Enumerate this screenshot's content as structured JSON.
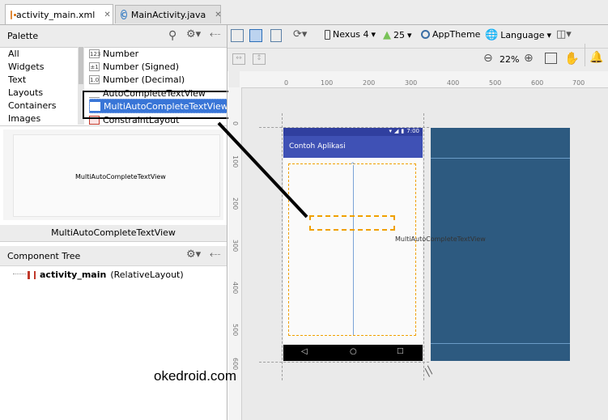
{
  "tabs": [
    {
      "label": "activity_main.xml",
      "active": true
    },
    {
      "label": "MainActivity.java",
      "active": false
    }
  ],
  "palette": {
    "title": "Palette",
    "categories": [
      "All",
      "Widgets",
      "Text",
      "Layouts",
      "Containers",
      "Images"
    ],
    "items": [
      {
        "icon_text": "123",
        "label": "Number"
      },
      {
        "icon_text": "±1",
        "label": "Number (Signed)"
      },
      {
        "icon_text": "1.0",
        "label": "Number (Decimal)"
      },
      {
        "icon_text": "",
        "label": "AutoCompleteTextView"
      },
      {
        "icon_text": "",
        "label": "MultiAutoCompleteTextView",
        "selected": true
      },
      {
        "icon_text": "",
        "label": "ConstraintLayout"
      }
    ],
    "preview_text": "MultiAutoCompleteTextView",
    "preview_caption": "MultiAutoCompleteTextView"
  },
  "component_tree": {
    "title": "Component Tree",
    "root_name": "activity_main",
    "root_type": "(RelativeLayout)"
  },
  "toolbar": {
    "device": "Nexus 4",
    "api": "25",
    "theme": "AppTheme",
    "language": "Language",
    "zoom": "22%"
  },
  "ruler": {
    "h_ticks": [
      "0",
      "100",
      "200",
      "300",
      "400",
      "500",
      "600",
      "700"
    ],
    "v_ticks": [
      "0",
      "100",
      "200",
      "300",
      "400",
      "500",
      "600"
    ]
  },
  "phone": {
    "status_time": "7:00",
    "app_title": "Contoh Aplikasi",
    "widget_label": "MultiAutoCompleteTextView",
    "primary_color": "#3f51b5",
    "blueprint_color": "#2d5a80"
  },
  "watermark": "okedroid.com",
  "colors": {
    "selection": "#3875d7",
    "guide": "#f0a000"
  }
}
